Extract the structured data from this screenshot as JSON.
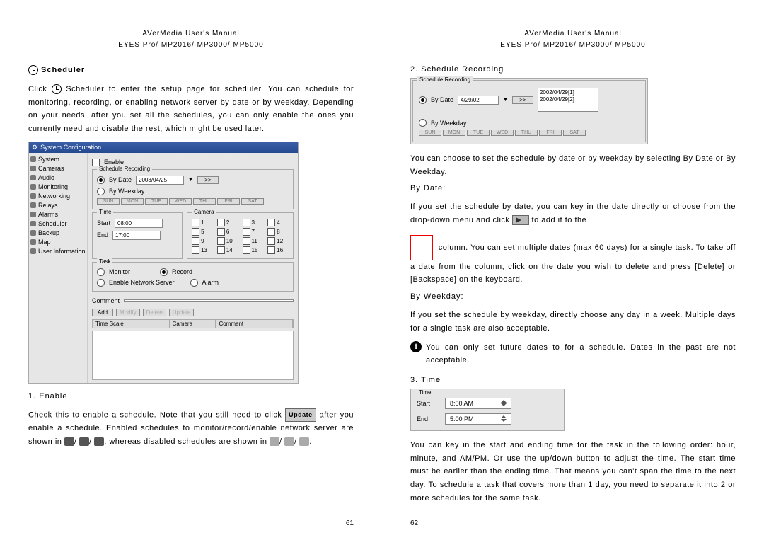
{
  "header": {
    "line1": "AVerMedia User's Manual",
    "line2": "EYES Pro/ MP2016/ MP3000/ MP5000"
  },
  "left": {
    "schedulerTitle": "Scheduler",
    "introA": "Click ",
    "introB": " Scheduler to enter the setup page for scheduler.  You can schedule for monitoring, recording, or enabling network server by date or by weekday.  Depending on your needs, after you set all the schedules, you can only enable the ones you currently need and disable the rest, which might be used later.",
    "config": {
      "title": "System Configuration",
      "sidebar": [
        "System",
        "Cameras",
        "Audio",
        "Monitoring",
        "Networking",
        "Relays",
        "Alarms",
        "Scheduler",
        "Backup",
        "Map",
        "User Information"
      ],
      "enable": "Enable",
      "scheduleRecording": "Schedule Recording",
      "byDate": "By Date",
      "dateValue": "2003/04/25",
      "addBtn": ">>",
      "byWeekday": "By Weekday",
      "days": [
        "SUN",
        "MON",
        "TUE",
        "WED",
        "THU",
        "FRI",
        "SAT"
      ],
      "time": "Time",
      "start": "Start",
      "startVal": "08:00",
      "end": "End",
      "endVal": "17:00",
      "camera": "Camera",
      "cams": [
        "1",
        "2",
        "3",
        "4",
        "5",
        "6",
        "7",
        "8",
        "9",
        "10",
        "11",
        "12",
        "13",
        "14",
        "15",
        "16"
      ],
      "task": "Task",
      "monitor": "Monitor",
      "record": "Record",
      "enableNetServer": "Enable Network Server",
      "alarm": "Alarm",
      "comment": "Comment",
      "btnAdd": "Add",
      "btnModify": "Modify",
      "btnDelete": "Delete",
      "btnUpdate": "Update",
      "colTime": "Time Scale",
      "colCamera": "Camera",
      "colComment": "Comment"
    },
    "item1": "1.  Enable",
    "enableText1": "Check this to enable a schedule.  Note that you still need to click",
    "updateBtn": "Update",
    "enableText2": " after you enable a schedule.   Enabled schedules to monitor/record/enable network server are shown in ",
    "enableText3": ", whereas disabled schedules are shown in ",
    "slash": "/",
    "period": ".",
    "pageNum": "61"
  },
  "right": {
    "item2": "2.  Schedule Recording",
    "schedRec": {
      "title": "Schedule Recording",
      "byDate": "By Date",
      "dateInput": "4/29/02",
      "addBtn": ">>",
      "listDates": [
        "2002/04/29[1]",
        "2002/04/29[2]"
      ],
      "byWeekday": "By Weekday",
      "days": [
        "SUN",
        "MON",
        "TUE",
        "WED",
        "THU",
        "FRI",
        "SAT"
      ]
    },
    "para1": "You can choose to set the schedule by date or by weekday by selecting By Date or By Weekday.",
    "byDateHead": "By Date:",
    "byDateText1": "If you set the schedule by date, you can key in the date directly or choose from the drop-down menu and click ",
    "byDateText2": " to add it to the",
    "byDateCol": " column.  You can set multiple dates (max 60 days) for a single task.  To take off a date from the column, click on the date you wish to delete and press [Delete] or [Backspace] on the keyboard.",
    "byWeekHead": "By Weekday:",
    "byWeekText": "If you set the schedule by weekday, directly choose any day in a week.  Multiple days for a single task are also acceptable.",
    "infoText": "You can only set future dates to for a schedule.  Dates in the past are not acceptable.",
    "item3": "3.  Time",
    "timePanel": {
      "title": "Time",
      "start": "Start",
      "startVal": "8:00 AM",
      "end": "End",
      "endVal": "5:00 PM"
    },
    "timeText": "You can key in the start and ending time for the task in the following order: hour, minute, and AM/PM.  Or use the up/down button to adjust the time.  The start time must be earlier than the ending time.  That means you can't span the time to the next day.  To schedule a task that covers more than 1 day, you need to separate it into 2 or more schedules for the same task.",
    "pageNum": "62"
  }
}
